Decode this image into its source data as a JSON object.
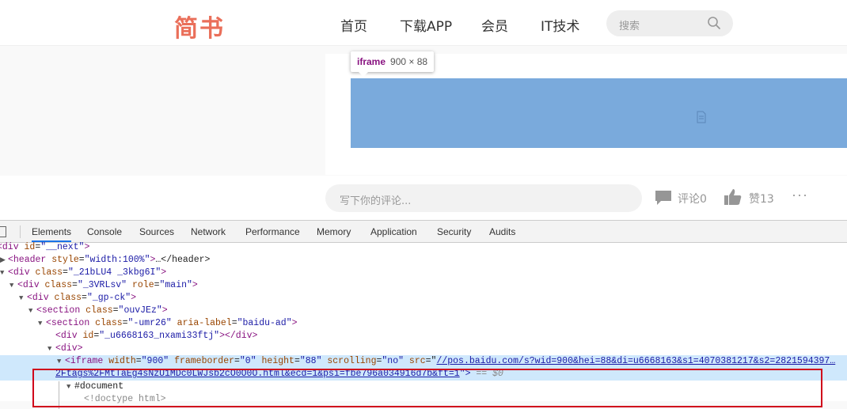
{
  "site": {
    "logo": "简书",
    "nav": [
      "首页",
      "下载APP",
      "会员",
      "IT技术"
    ],
    "search_placeholder": "搜索"
  },
  "tooltip": {
    "tag": "iframe",
    "dims": "900 × 88"
  },
  "comment_bar": {
    "placeholder": "写下你的评论...",
    "comment_label": "评论0",
    "like_label": "赞13",
    "more": "···"
  },
  "devtools": {
    "tabs": [
      "Elements",
      "Console",
      "Sources",
      "Network",
      "Performance",
      "Memory",
      "Application",
      "Security",
      "Audits"
    ],
    "active_tab": "Elements",
    "lines": {
      "l0_tag": "div",
      "l0_attr": "id",
      "l0_val": "\"__next\"",
      "l1_tag": "header",
      "l1_attr": "style",
      "l1_val": "\"width:100%\"",
      "l1_rest": "…</header>",
      "l2_tag": "div",
      "l2_attr": "class",
      "l2_val": "\"_21bLU4 _3kbg6I\"",
      "l3_tag": "div",
      "l3_attr1": "class",
      "l3_val1": "\"_3VRLsv\"",
      "l3_attr2": "role",
      "l3_val2": "\"main\"",
      "l4_tag": "div",
      "l4_attr": "class",
      "l4_val": "\"_gp-ck\"",
      "l5_tag": "section",
      "l5_attr": "class",
      "l5_val": "\"ouvJEz\"",
      "l6_tag": "section",
      "l6_attr1": "class",
      "l6_val1": "\"-umr26\"",
      "l6_attr2": "aria-label",
      "l6_val2": "\"baidu-ad\"",
      "l7_tag": "div",
      "l7_attr": "id",
      "l7_val": "\"_u6668163_nxami33ftj\"",
      "l7_close": "</div>",
      "l8_tag": "<div>",
      "l9_tag": "iframe",
      "l9_a1": "width",
      "l9_v1": "\"900\"",
      "l9_a2": "frameborder",
      "l9_v2": "\"0\"",
      "l9_a3": "height",
      "l9_v3": "\"88\"",
      "l9_a4": "scrolling",
      "l9_v4": "\"no\"",
      "l9_a5": "src",
      "l9_link1": "//pos.baidu.com/s?wid=900&hei=88&di=u6668163&s1=4070381217&s2=2821594397…",
      "l9_link2": "2Ftags%2FMtTaEg4sNzU1MDc0LWJsb2cO0O0O.html&ecd=1&psi=fbe796a034916d7b&ft=1",
      "l9_end": "\">",
      "l9_sel": "== $0",
      "l10": "#document",
      "l11": "<!doctype html>"
    }
  },
  "colors": {
    "brand": "#ea6f5a",
    "ad_overlay": "#7aaadc",
    "selection": "#cfe8fc",
    "highlight_box": "#d0021b"
  }
}
